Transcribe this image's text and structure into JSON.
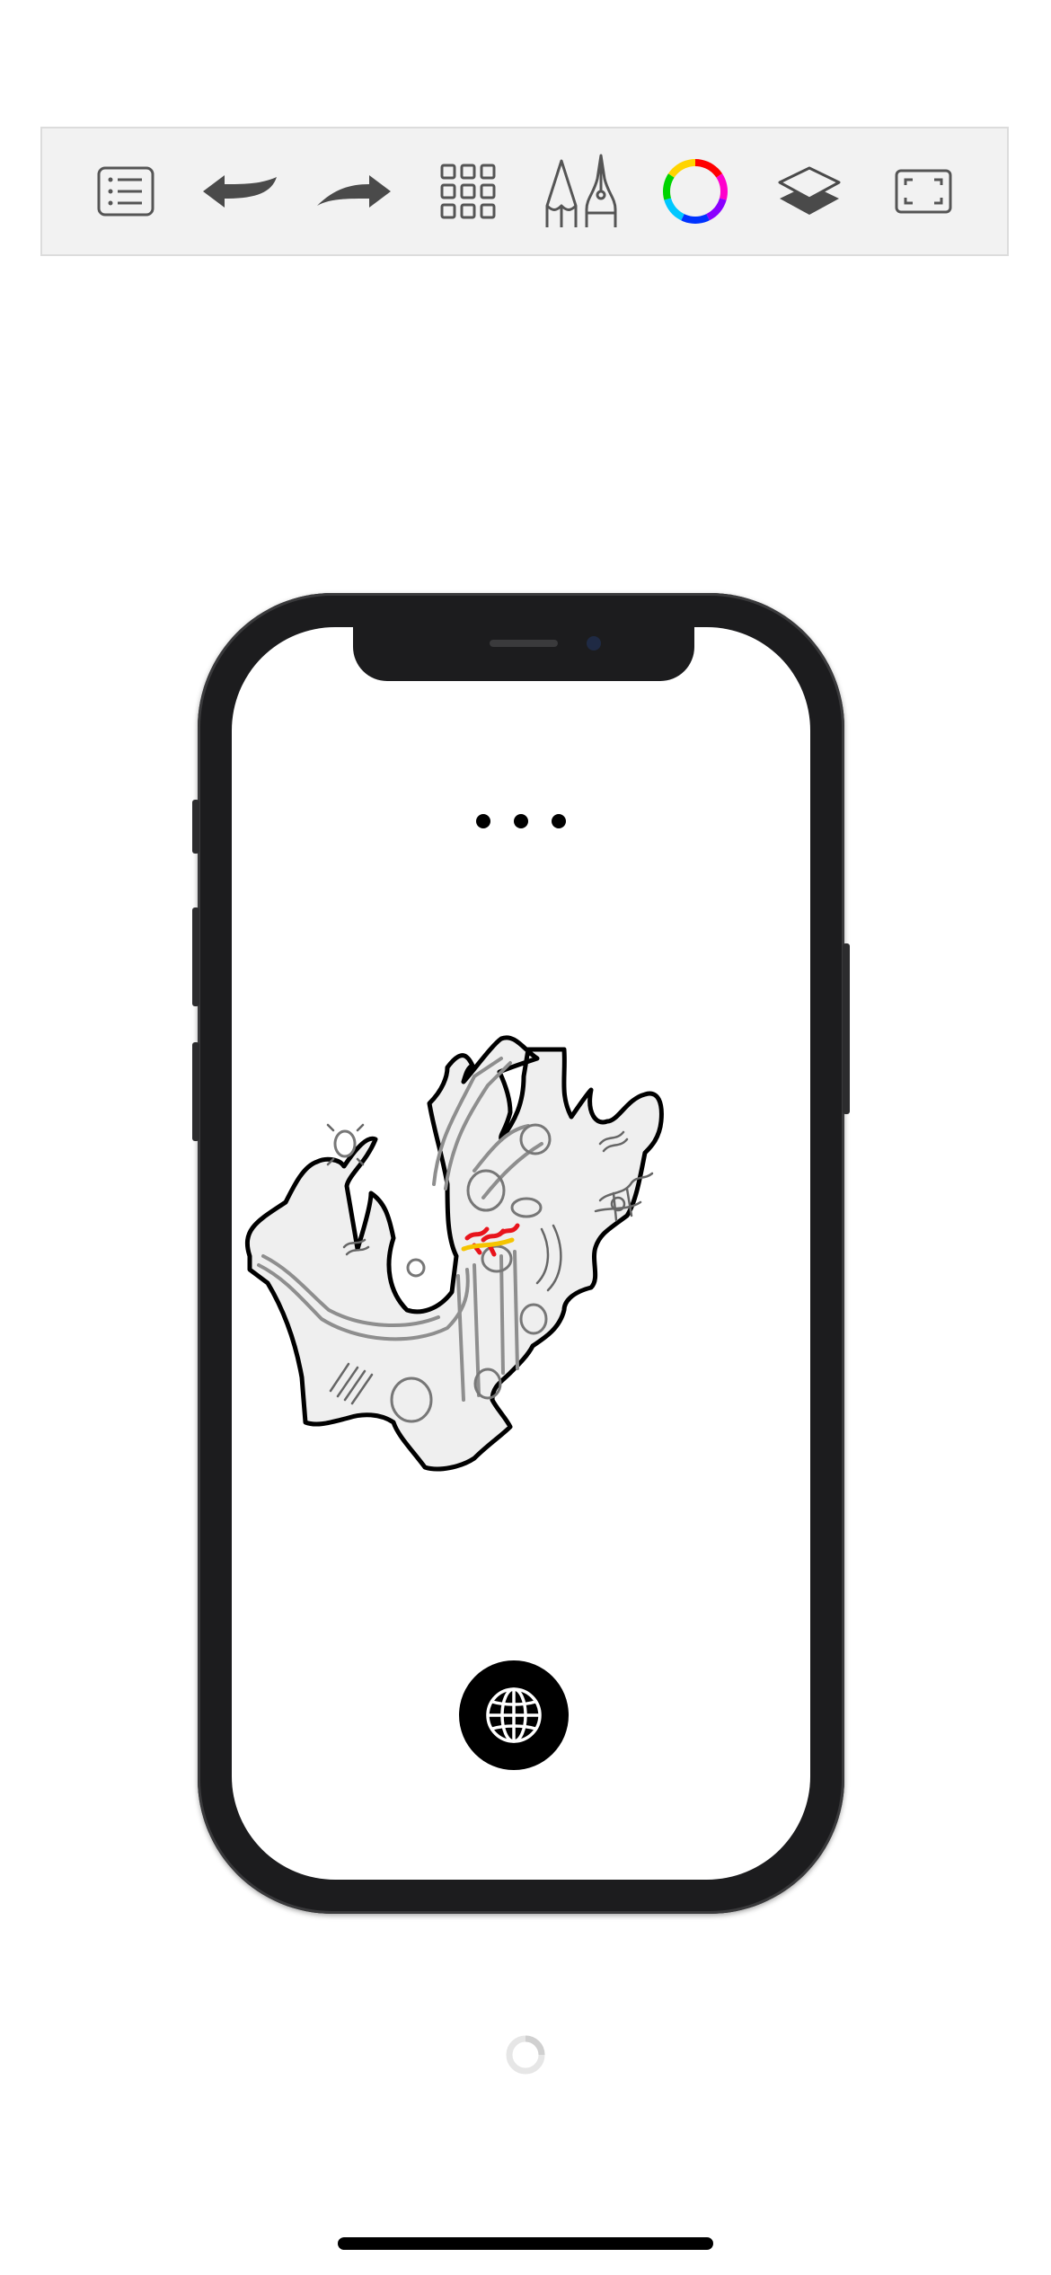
{
  "toolbar": {
    "tools": [
      {
        "icon": "list-icon",
        "name": "menu"
      },
      {
        "icon": "undo-icon",
        "name": "undo"
      },
      {
        "icon": "redo-icon",
        "name": "redo"
      },
      {
        "icon": "grid-icon",
        "name": "gallery"
      },
      {
        "icon": "drawing-tools-icon",
        "name": "tools"
      },
      {
        "icon": "color-wheel-icon",
        "name": "color"
      },
      {
        "icon": "layers-icon",
        "name": "layers"
      },
      {
        "icon": "fullscreen-icon",
        "name": "fullscreen"
      }
    ]
  },
  "device": {
    "model": "phone-mockup",
    "menu_dots": 3,
    "action_button_icon": "globe-icon"
  },
  "canvas": {
    "content": "map-drawing",
    "fill_color": "#efefef",
    "stroke_color": "#000000",
    "accent_colors": [
      "#e8141c",
      "#f5c400"
    ]
  },
  "status": {
    "loading_indicator": "spinner-icon"
  }
}
